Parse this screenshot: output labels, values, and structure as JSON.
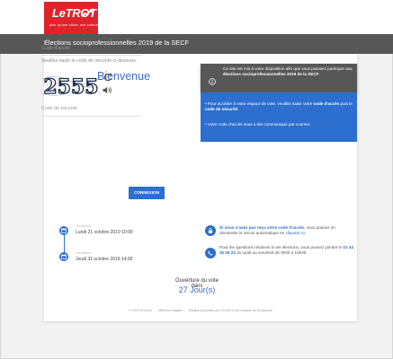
{
  "brand": {
    "logo_text": "LeTROT",
    "tagline": "plus qu'une allure, une culture",
    "color": "#e2222b"
  },
  "titlebar": {
    "title": "Élections socioprofessionnelles 2019 de la SECF",
    "color": "#575757"
  },
  "login": {
    "welcome": "Bienvenue",
    "access_code_placeholder": "Code d'accès",
    "captcha_hint": "Veuillez saisir le code de sécurité ci-dessous :",
    "captcha_text": "2555",
    "security_code_placeholder": "Code de sécurité",
    "connect_label": "CONNEXION",
    "accent": "#2d6fce"
  },
  "info": {
    "notice_pre": "Ce site est mis à votre disposition afin que vous puissiez participer aux ",
    "notice_bold": "élections socioprofessionnelles 2019 de la SECF",
    "notice_post": ".",
    "bullet1_pre": "Pour accéder à votre espace de vote, veuillez saisir votre ",
    "bullet1_bold1": "code d'accès",
    "bullet1_mid": " puis le ",
    "bullet1_bold2": "code de sécurité",
    "bullet1_post": ".",
    "bullet2": "Votre code d'accès vous a été communiqué par courrier."
  },
  "timeline": {
    "open_label": "Ouverture",
    "open_date": "Lundi 21 octobre 2019 10:00",
    "close_label": "Fermeture",
    "close_date": "Jeudi 31 octobre 2019 14:00"
  },
  "help": {
    "lost_bold": "Si vous n'avez pas reçu votre code d'accès",
    "lost_mid": ", vous pouvez en demander le renvoi automatique en ",
    "lost_link": "cliquant ici",
    "lost_post": ".",
    "questions_pre": "Pour les questions relatives à ces élections, vous pouvez joindre le ",
    "questions_phone": "01 44 30 05 22",
    "questions_post": " du lundi au vendredi de 9h00 à 18h00."
  },
  "vote": {
    "label": "Ouverture du vote dans",
    "countdown": "27 Jour(s)"
  },
  "footer": {
    "copyright": "© 2019 VOXALY",
    "legal": "Mentions légales",
    "powered": "Solution proposée par VOXALY une marque de Docaposte"
  }
}
